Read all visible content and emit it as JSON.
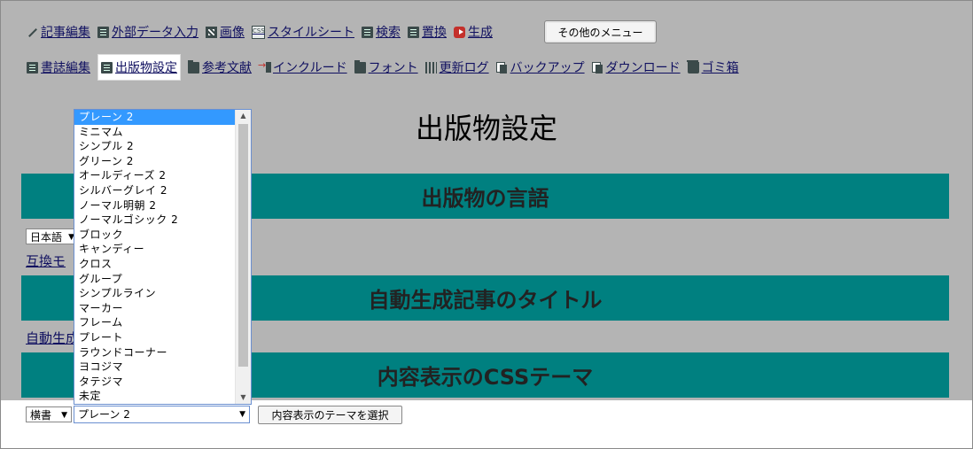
{
  "nav_row1": [
    {
      "name": "nav-article-edit",
      "icon": "pen-icon",
      "label": "記事編集"
    },
    {
      "name": "nav-external-data",
      "icon": "document-icon",
      "label": "外部データ入力"
    },
    {
      "name": "nav-image",
      "icon": "image-icon",
      "label": "画像"
    },
    {
      "name": "nav-stylesheet",
      "icon": "css-icon",
      "label": "スタイルシート"
    },
    {
      "name": "nav-search",
      "icon": "document-icon",
      "label": "検索"
    },
    {
      "name": "nav-replace",
      "icon": "document-icon",
      "label": "置換"
    },
    {
      "name": "nav-generate",
      "icon": "play-icon",
      "label": "生成"
    }
  ],
  "other_menu_label": "その他のメニュー",
  "nav_row2": [
    {
      "name": "nav-book-edit",
      "icon": "document-icon",
      "label": "書誌編集"
    },
    {
      "name": "nav-publication-settings",
      "icon": "document-icon",
      "label": "出版物設定",
      "active": true
    },
    {
      "name": "nav-references",
      "icon": "folder-icon",
      "label": "参考文献"
    },
    {
      "name": "nav-include",
      "icon": "include-icon",
      "label": "インクルード"
    },
    {
      "name": "nav-font",
      "icon": "folder-icon",
      "label": "フォント"
    },
    {
      "name": "nav-update-log",
      "icon": "grid-icon",
      "label": "更新ログ"
    },
    {
      "name": "nav-backup",
      "icon": "copy-icon",
      "label": "バックアップ"
    },
    {
      "name": "nav-download",
      "icon": "copy-icon",
      "label": "ダウンロード"
    },
    {
      "name": "nav-trash",
      "icon": "trash-icon",
      "label": "ゴミ箱"
    }
  ],
  "page_title": "出版物設定",
  "sections": {
    "language": {
      "heading": "出版物の言語",
      "selected": "日本語",
      "link": "互換モ"
    },
    "auto_title": {
      "heading": "自動生成記事のタイトル",
      "link": "自動生成"
    },
    "css_theme": {
      "heading": "内容表示のCSSテーマ",
      "writing_mode": "横書",
      "theme_selected": "プレーン 2",
      "apply_label": "内容表示のテーマを選択"
    }
  },
  "theme_options": [
    "プレーン 2",
    "ミニマム",
    "シンプル 2",
    "グリーン 2",
    "オールディーズ 2",
    "シルバーグレイ 2",
    "ノーマル明朝 2",
    "ノーマルゴシック 2",
    "ブロック",
    "キャンディー",
    "クロス",
    "グループ",
    "シンプルライン",
    "マーカー",
    "フレーム",
    "プレート",
    "ラウンドコーナー",
    "ヨコジマ",
    "タテジマ",
    "未定"
  ],
  "colors": {
    "section_bar": "#008080",
    "page_bg": "#b4b4b4",
    "selected_option": "#3399ff"
  }
}
